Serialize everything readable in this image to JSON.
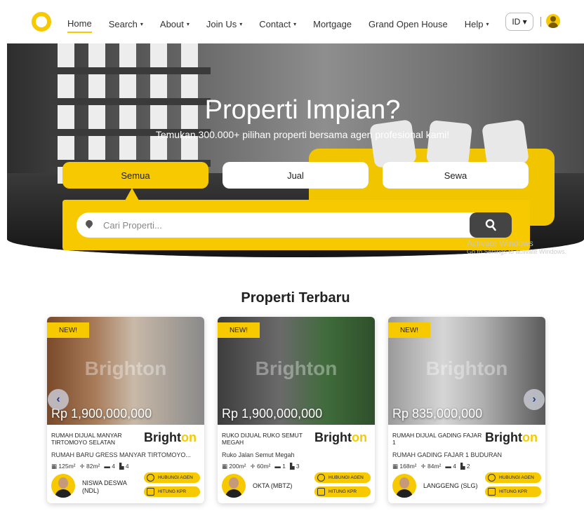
{
  "nav": {
    "items": [
      {
        "label": "Home",
        "caret": ""
      },
      {
        "label": "Search",
        "caret": "▾"
      },
      {
        "label": "About",
        "caret": "▾"
      },
      {
        "label": "Join Us",
        "caret": "▾"
      },
      {
        "label": "Contact",
        "caret": "▾"
      },
      {
        "label": "Mortgage",
        "caret": ""
      },
      {
        "label": "Grand Open House",
        "caret": ""
      },
      {
        "label": "Help",
        "caret": "▾"
      }
    ],
    "language": "ID ▾"
  },
  "hero": {
    "title": "Properti Impian?",
    "subtitle": "Temukan 300.000+ pilihan properti bersama agen profesional kami!",
    "tabs": [
      "Semua",
      "Jual",
      "Sewa"
    ],
    "search_placeholder": "Cari Properti..."
  },
  "watermark": {
    "title": "Activate Windows",
    "subtitle": "Go to Settings to activate Windows."
  },
  "section": {
    "title": "Properti Terbaru"
  },
  "colors": {
    "accent": "#f7c900",
    "dark": "#444444"
  },
  "cards": [
    {
      "badge": "NEW!",
      "watermark": "Brighton",
      "price": "Rp 1,900,000,000",
      "title": "RUMAH DIJUAL MANYAR TIRTOMOYO SELATAN",
      "brand_a": "Bright",
      "brand_b": "on",
      "subtitle": "RUMAH BARU GRESS MANYAR TIRTOMOYO...",
      "specs": [
        "▦ 125m²",
        "✛ 82m²",
        "▬ 4",
        "▙ 4"
      ],
      "agent": "NISWA DESWA (NDL)",
      "btn_agent": "HUBUNGI AGEN",
      "btn_kpr": "HITUNG KPR"
    },
    {
      "badge": "NEW!",
      "watermark": "Brighton",
      "price": "Rp 1,900,000,000",
      "title": "RUKO DIJUAL RUKO SEMUT MEGAH",
      "brand_a": "Bright",
      "brand_b": "on",
      "subtitle": "Ruko Jalan Semut Megah",
      "specs": [
        "▦ 200m²",
        "✛ 60m²",
        "▬ 1",
        "▙ 3"
      ],
      "agent": "OKTA (MBTZ)",
      "btn_agent": "HUBUNGI AGEN",
      "btn_kpr": "HITUNG KPR"
    },
    {
      "badge": "NEW!",
      "watermark": "Brighton",
      "price": "Rp 835,000,000",
      "title": "RUMAH DIJUAL GADING FAJAR 1",
      "brand_a": "Bright",
      "brand_b": "on",
      "subtitle": "RUMAH GADING FAJAR 1 BUDURAN",
      "specs": [
        "▦ 168m²",
        "✛ 84m²",
        "▬ 4",
        "▙ 2"
      ],
      "agent": "LANGGENG (SLG)",
      "btn_agent": "HUBUNGI AGEN",
      "btn_kpr": "HITUNG KPR"
    }
  ],
  "arrows": {
    "prev": "‹",
    "next": "›"
  }
}
